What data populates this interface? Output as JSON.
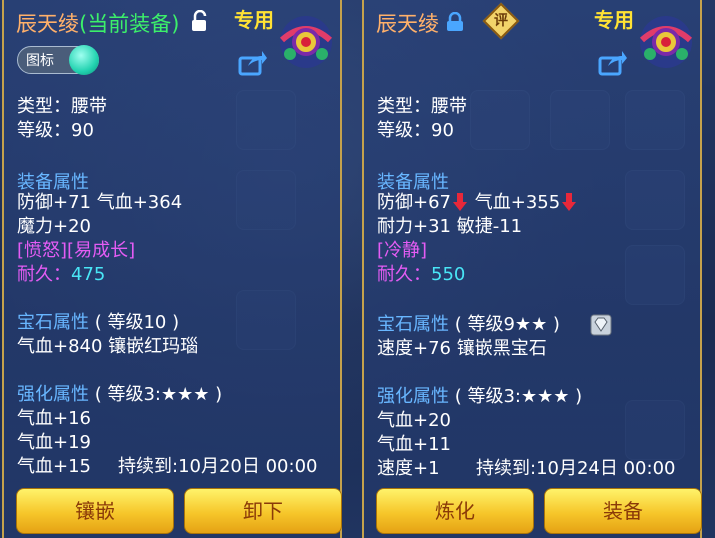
{
  "left": {
    "name": "辰天绫",
    "current": "(当前装备)",
    "exclusive": "专用",
    "toggle_label": "图标",
    "type": "类型：腰带",
    "level": "等级：90",
    "attr_title": "装备属性",
    "attrs": [
      "防御+71 气血+364",
      "魔力+20"
    ],
    "specials": "[愤怒][易成长]",
    "dur_label": "耐久：",
    "dur_value": "475",
    "gem_title": "宝石属性",
    "gem_level": "( 等级10 )",
    "gem_line": "气血+840 镶嵌红玛瑙",
    "enh_title": "强化属性",
    "enh_level": "( 等级3:★★★ )",
    "enh_lines": [
      "气血+16",
      "气血+19",
      "气血+15"
    ],
    "expire": "持续到:10月20日 00:00",
    "buttons": [
      "镶嵌",
      "卸下"
    ]
  },
  "right": {
    "name": "辰天绫",
    "eval_badge": "评",
    "exclusive": "专用",
    "type": "类型：腰带",
    "level": "等级：90",
    "attr_title": "装备属性",
    "attr1a": "防御+67",
    "attr1b": "气血+355",
    "attr2": "耐力+31 敏捷-11",
    "specials": "[冷静]",
    "dur_label": "耐久：",
    "dur_value": "550",
    "gem_title": "宝石属性",
    "gem_level": "( 等级9★★ )",
    "gem_line": "速度+76 镶嵌黑宝石",
    "enh_title": "强化属性",
    "enh_level": "( 等级3:★★★ )",
    "enh_lines": [
      "气血+20",
      "气血+11",
      "速度+1"
    ],
    "expire": "持续到:10月24日 00:00",
    "buttons": [
      "炼化",
      "装备"
    ]
  },
  "colors": {
    "title": "#ffb06a",
    "section": "#68b6ff",
    "special": "#e45cf4",
    "durability": "#49e6f6",
    "button": "#f6c62a"
  }
}
